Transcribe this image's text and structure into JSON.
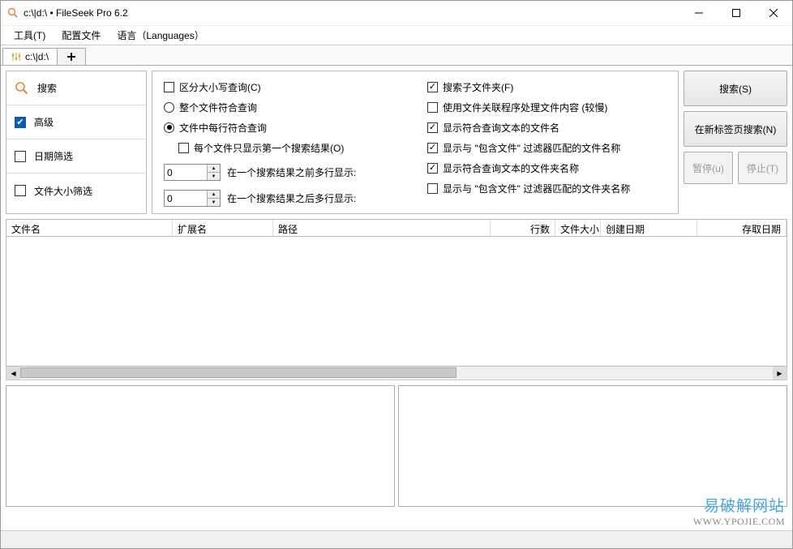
{
  "title": "c:\\|d:\\ • FileSeek Pro 6.2",
  "menu": {
    "tools": "工具(T)",
    "config": "配置文件",
    "lang": "语言（Languages）"
  },
  "tab": {
    "label": "c:\\|d:\\"
  },
  "nav": {
    "search": "搜索",
    "advanced": "高级",
    "date": "日期筛选",
    "size": "文件大小筛选"
  },
  "opts": {
    "case": "区分大小写查询(C)",
    "whole": "整个文件符合查询",
    "perline": "文件中每行符合查询",
    "firstonly": "每个文件只显示第一个搜索结果(O)",
    "before_label": "在一个搜索结果之前多行显示:",
    "after_label": "在一个搜索结果之后多行显示:",
    "before_val": "0",
    "after_val": "0",
    "subfolders": "搜索子文件夹(F)",
    "filehandlers": "使用文件关联程序处理文件内容 (较慢)",
    "matchtext": "显示符合查询文本的文件名",
    "incfilter_file": "显示与 \"包含文件\" 过滤器匹配的文件名称",
    "matchfolder": "显示符合查询文本的文件夹名称",
    "incfilter_folder": "显示与 \"包含文件\" 过滤器匹配的文件夹名称"
  },
  "buttons": {
    "search": "搜索(S)",
    "newtab": "在新标签页搜索(N)",
    "pause": "暂停(u)",
    "stop": "停止(T)"
  },
  "columns": {
    "name": "文件名",
    "ext": "扩展名",
    "path": "路径",
    "lines": "行数",
    "size": "文件大小",
    "created": "创建日期",
    "accessed": "存取日期"
  },
  "watermark": {
    "l1": "易破解网站",
    "l2": "WWW.YPOJIE.COM"
  }
}
